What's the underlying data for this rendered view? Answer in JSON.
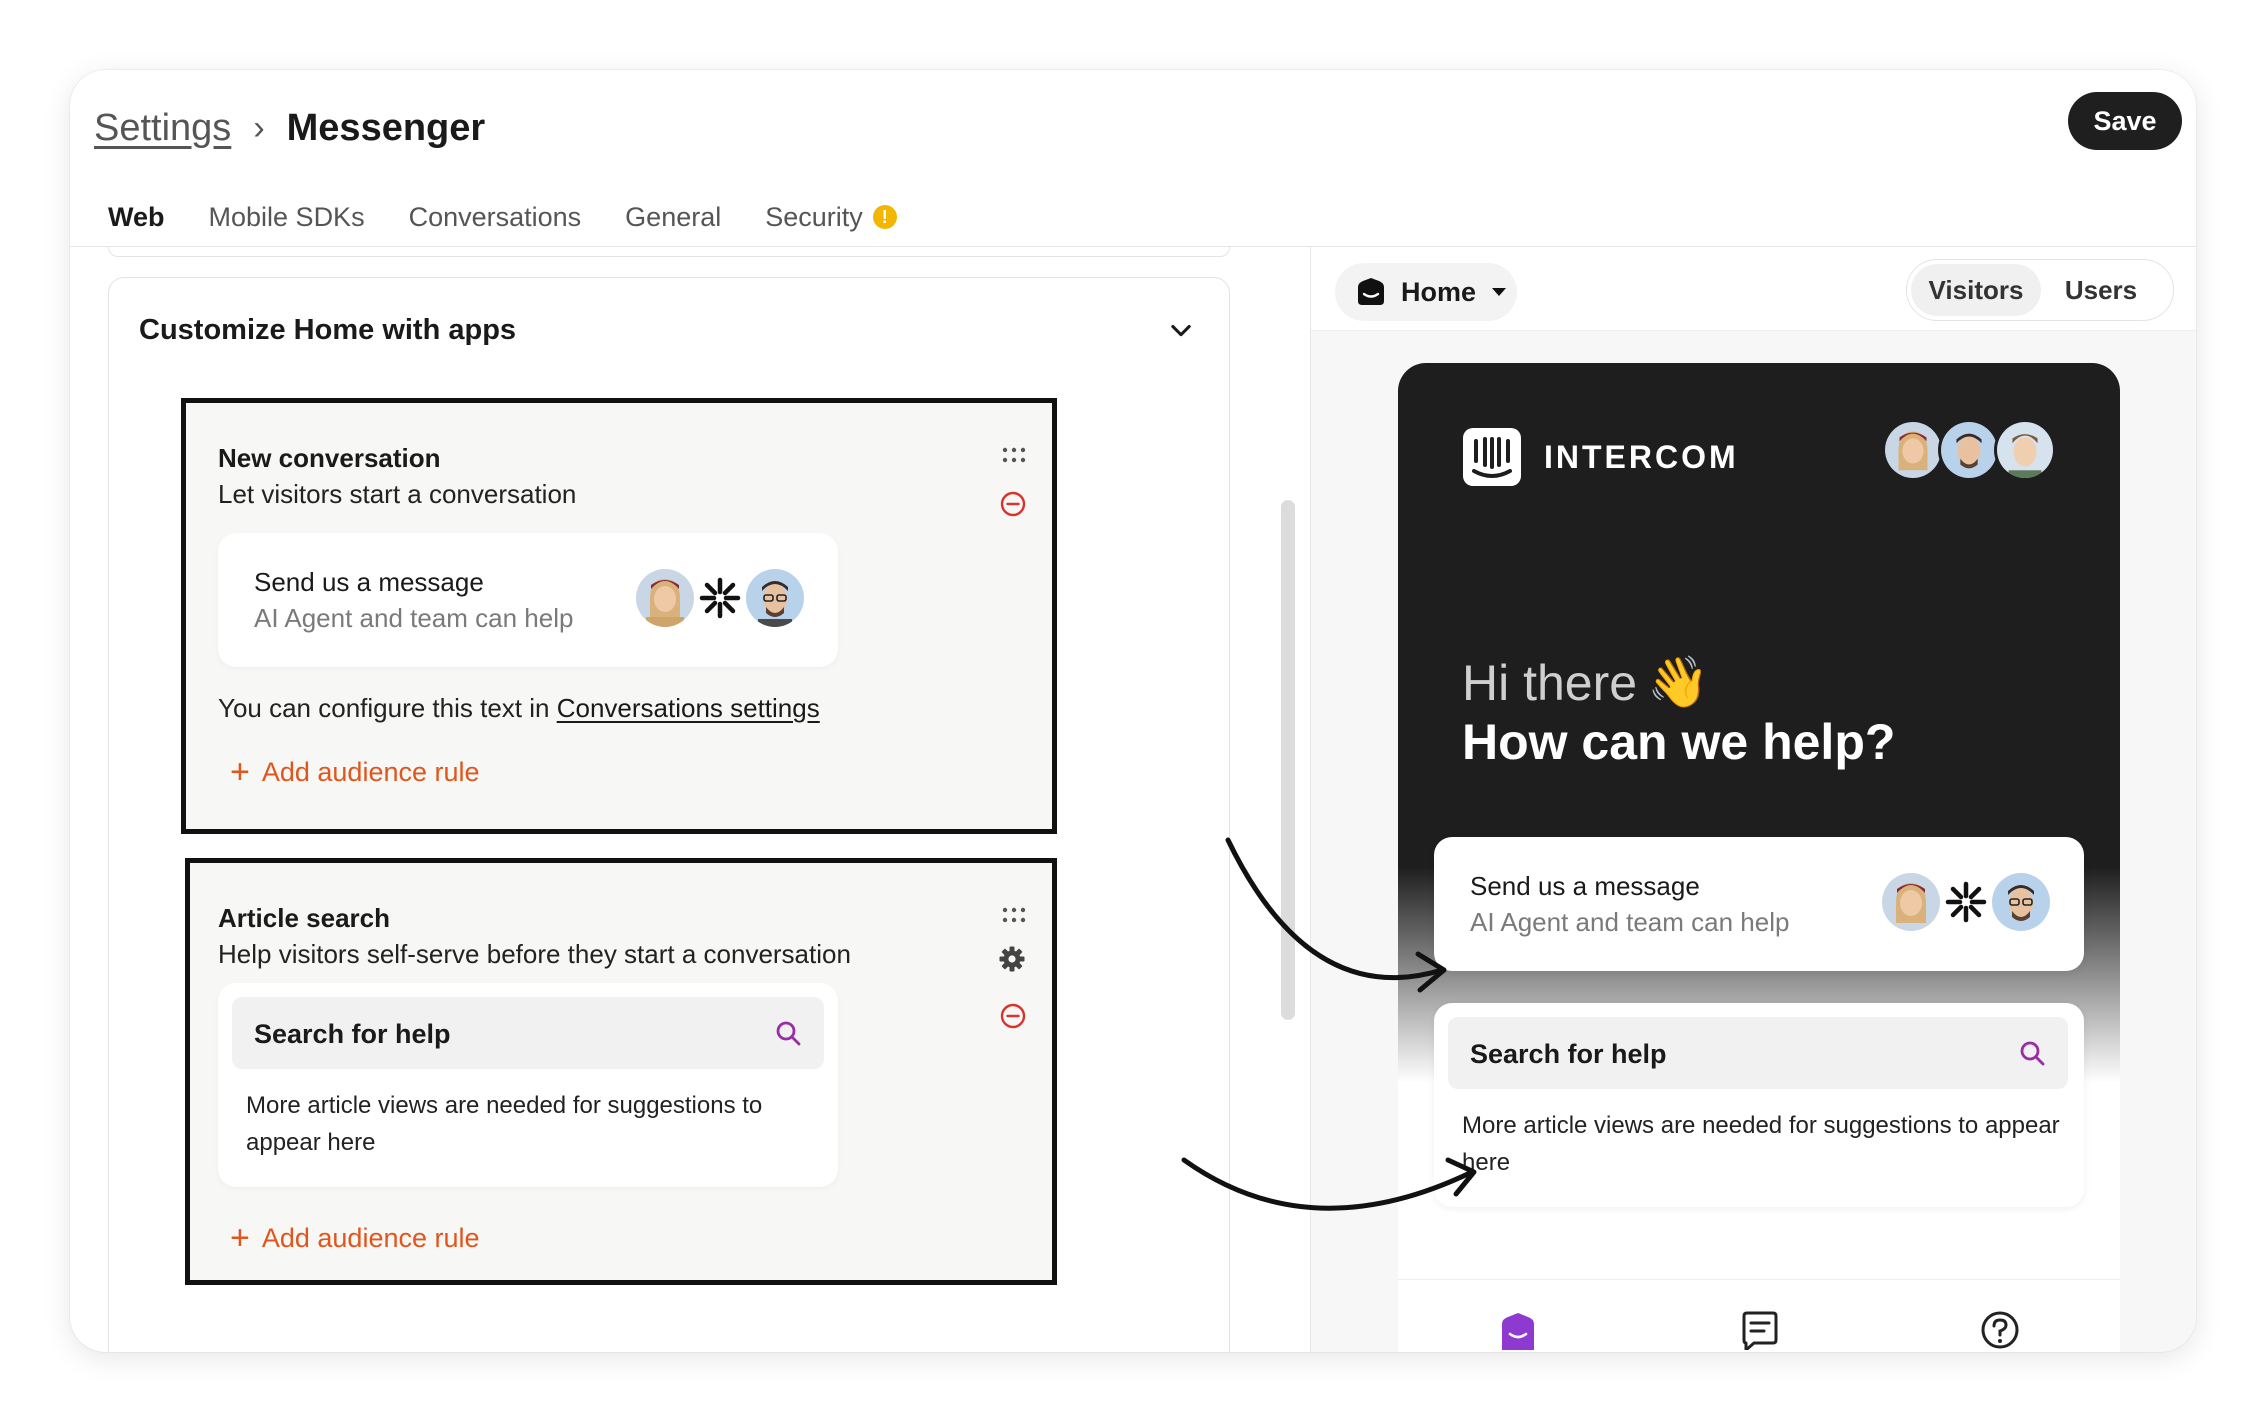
{
  "header": {
    "breadcrumb_parent": "Settings",
    "breadcrumb_separator": "›",
    "page_title": "Messenger",
    "save_label": "Save"
  },
  "tabs": [
    {
      "label": "Web",
      "active": true
    },
    {
      "label": "Mobile SDKs",
      "active": false
    },
    {
      "label": "Conversations",
      "active": false
    },
    {
      "label": "General",
      "active": false
    },
    {
      "label": "Security",
      "active": false,
      "badge": "!"
    }
  ],
  "panel": {
    "title": "Customize Home with apps",
    "new_conversation": {
      "title": "New conversation",
      "description": "Let visitors start a conversation",
      "card_title": "Send us a message",
      "card_subtitle": "AI Agent and team can help",
      "config_note_prefix": "You can configure this text in ",
      "config_link": "Conversations settings",
      "add_rule": "Add audience rule"
    },
    "article_search": {
      "title": "Article search",
      "description": "Help visitors self-serve before they start a conversation",
      "search_label": "Search for help",
      "search_note": "More article views are needed for suggestions to appear here",
      "add_rule": "Add audience rule"
    }
  },
  "preview": {
    "home_selector": "Home",
    "audience_toggle": [
      "Visitors",
      "Users"
    ],
    "brand": "INTERCOM",
    "greeting": "Hi there",
    "greeting_emoji": "👋",
    "question": "How can we help?",
    "message_card": {
      "title": "Send us a message",
      "subtitle": "AI Agent and team can help"
    },
    "search_card": {
      "label": "Search for help",
      "note": "More article views are needed for suggestions to appear here"
    }
  },
  "colors": {
    "accent": "#e0561c",
    "dark": "#1e1e1e",
    "search_icon": "#9b2ca8",
    "remove_icon": "#d6342c",
    "warning": "#f2b705",
    "home_tab_icon": "#8e3ad1"
  }
}
